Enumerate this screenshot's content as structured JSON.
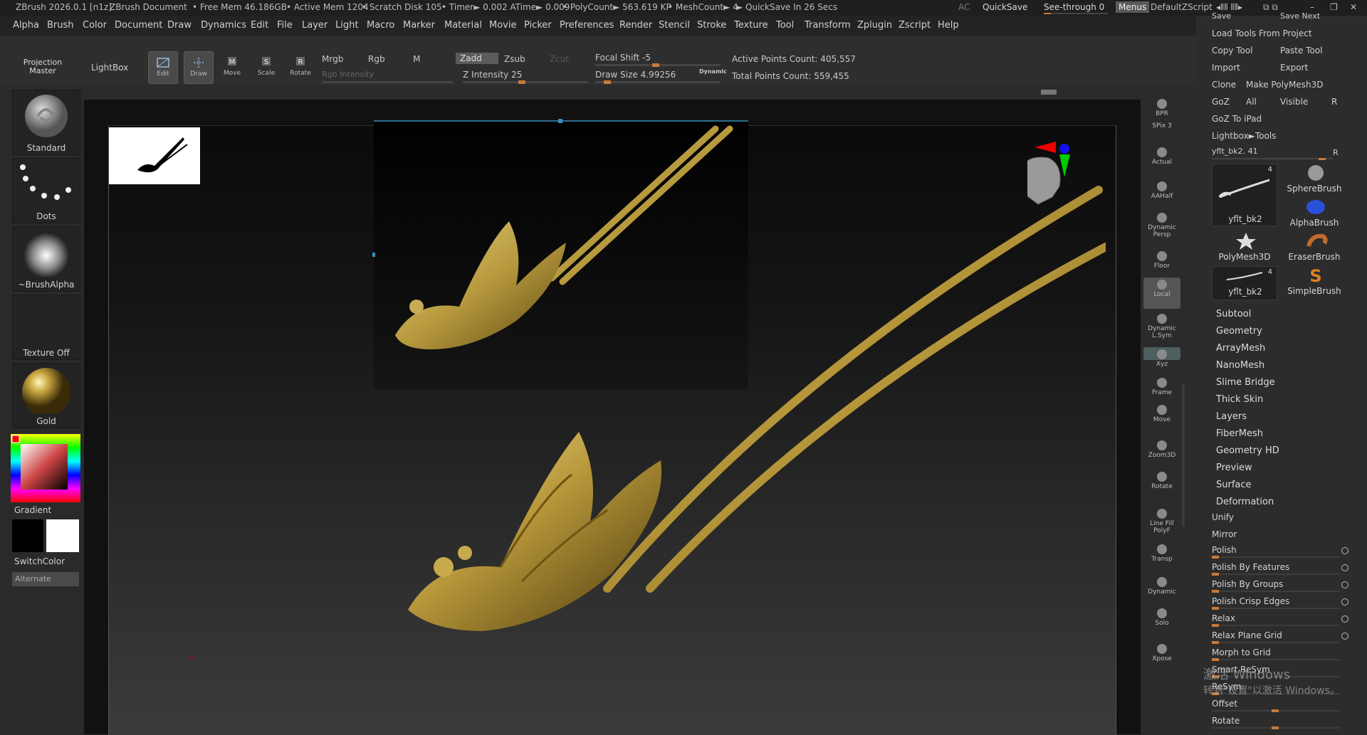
{
  "titlebar": {
    "app": "ZBrush 2026.0.1 [n1z]",
    "doc": "ZBrush Document",
    "free_mem": "• Free Mem 46.186GB",
    "active_mem": "• Active Mem 1204",
    "scratch": "• Scratch Disk 105",
    "timer": "• Timer► 0.002 ATime► 0.009",
    "polycount": "• PolyCount► 563.619 KP",
    "meshcount": "• MeshCount► 4",
    "quicksave_in": "► QuickSave In 26 Secs",
    "ac": "AC",
    "quicksave": "QuickSave",
    "seethrough": "See-through  0",
    "menus": "Menus",
    "default_zscript": "DefaultZScript"
  },
  "menu": [
    "Alpha",
    "Brush",
    "Color",
    "Document",
    "Draw",
    "Dynamics",
    "Edit",
    "File",
    "Layer",
    "Light",
    "Macro",
    "Marker",
    "Material",
    "Movie",
    "Picker",
    "Preferences",
    "Render",
    "Stencil",
    "Stroke",
    "Texture",
    "Tool",
    "Transform",
    "Zplugin",
    "Zscript",
    "Help"
  ],
  "topshelf": {
    "projection_master": "Projection Master",
    "lightbox": "LightBox",
    "tools": [
      {
        "label": "Edit",
        "icon": "edit-icon"
      },
      {
        "label": "Draw",
        "icon": "draw-icon"
      },
      {
        "label": "Move",
        "icon": "move-icon"
      },
      {
        "label": "Scale",
        "icon": "scale-icon"
      },
      {
        "label": "Rotate",
        "icon": "rotate-icon"
      }
    ],
    "mrgb": "Mrgb",
    "rgb": "Rgb",
    "m": "M",
    "rgb_intensity": "Rgb Intensity",
    "zadd": "Zadd",
    "zsub": "Zsub",
    "zcut": "Zcut",
    "z_intensity": "Z Intensity 25",
    "focal_shift": "Focal Shift -5",
    "draw_size": "Draw Size 4.99256",
    "dynamic": "Dynamic",
    "active_points": "Active Points Count: 405,557",
    "total_points": "Total Points Count: 559,455"
  },
  "lefttray": {
    "brush": "Standard",
    "stroke": "Dots",
    "alpha": "~BrushAlpha",
    "texture": "Texture Off",
    "material": "Gold",
    "gradient": "Gradient",
    "switchcolor": "SwitchColor",
    "alternate": "Alternate"
  },
  "rightshelf": [
    {
      "label": "BPR",
      "icon": "bpr-icon"
    },
    {
      "label": "SPix 3",
      "icon": ""
    },
    {
      "label": "Actual",
      "icon": "actual-icon"
    },
    {
      "label": "AAHalf",
      "icon": "aahalf-icon"
    },
    {
      "label": "Dynamic Persp",
      "icon": "persp-icon"
    },
    {
      "label": "Floor",
      "icon": "floor-icon"
    },
    {
      "label": "Local",
      "icon": "local-icon"
    },
    {
      "label": "Dynamic L.Sym",
      "icon": "lsym-icon"
    },
    {
      "label": "Xyz",
      "icon": "xyz-icon"
    },
    {
      "label": "Frame",
      "icon": "frame-icon"
    },
    {
      "label": "Move",
      "icon": "move-icon"
    },
    {
      "label": "Zoom3D",
      "icon": "zoom-icon"
    },
    {
      "label": "Rotate",
      "icon": "rotate-icon"
    },
    {
      "label": "Line Fill PolyF",
      "icon": "polyf-icon"
    },
    {
      "label": "Transp",
      "icon": "transp-icon"
    },
    {
      "label": "Dynamic",
      "icon": "ghost-icon"
    },
    {
      "label": "Solo",
      "icon": "solo-icon"
    },
    {
      "label": "Xpose",
      "icon": "xpose-icon"
    }
  ],
  "rightpanel": {
    "save": "Save",
    "save_next": "Save Next",
    "load_tools": "Load Tools From Project",
    "copy_tool": "Copy Tool",
    "paste_tool": "Paste Tool",
    "import": "Import",
    "export": "Export",
    "clone": "Clone",
    "make_polymesh": "Make PolyMesh3D",
    "goz": "GoZ",
    "all": "All",
    "visible": "Visible",
    "r": "R",
    "goz_ipad": "GoZ To iPad",
    "lightbox_tools": "Lightbox►Tools",
    "tool_name": "yflt_bk2. 41",
    "tool_r": "R",
    "tools": [
      {
        "label": "yflt_bk2",
        "count": "4"
      },
      {
        "label": "SphereBrush",
        "count": ""
      },
      {
        "label": "AlphaBrush",
        "count": ""
      },
      {
        "label": "PolyMesh3D",
        "count": ""
      },
      {
        "label": "EraserBrush",
        "count": ""
      },
      {
        "label": "yflt_bk2",
        "count": "4"
      },
      {
        "label": "SimpleBrush",
        "count": ""
      }
    ],
    "sections": [
      "Subtool",
      "Geometry",
      "ArrayMesh",
      "NanoMesh",
      "Slime Bridge",
      "Thick Skin",
      "Layers",
      "FiberMesh",
      "Geometry HD",
      "Preview",
      "Surface",
      "Deformation"
    ],
    "deformation": [
      "Unify",
      "Mirror",
      "Polish",
      "Polish By Features",
      "Polish By Groups",
      "Polish Crisp Edges",
      "Relax",
      "Relax Plane Grid",
      "Morph to Grid",
      "Smart ReSym",
      "ReSym",
      "Offset",
      "Rotate"
    ],
    "watermark_1": "激活 Windows",
    "watermark_2": "转到\"设置\"以激活 Windows。"
  },
  "colors": {
    "accent": "#c77a3a",
    "gold": "#b89a3e",
    "panel": "#2c2c2c"
  }
}
